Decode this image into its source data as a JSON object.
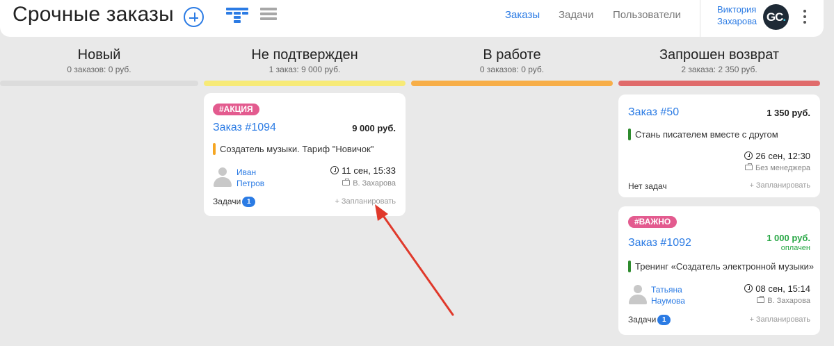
{
  "header": {
    "title": "Срочные заказы",
    "nav": [
      "Заказы",
      "Задачи",
      "Пользователи"
    ],
    "user_first": "Виктория",
    "user_last": "Захарова",
    "avatar_initials": "GC",
    "avatar_dot": "."
  },
  "columns": [
    {
      "title": "Новый",
      "summary": "0 заказов: 0 руб.",
      "color": "#dcdcdc"
    },
    {
      "title": "Не подтвержден",
      "summary": "1 заказ: 9 000 руб.",
      "color": "#f7ea77"
    },
    {
      "title": "В работе",
      "summary": "0 заказов: 0 руб.",
      "color": "#f7ae48"
    },
    {
      "title": "Запрошен возврат",
      "summary": "2 заказа: 2 350 руб.",
      "color": "#e06b6b"
    }
  ],
  "cards": {
    "c1094": {
      "tag": "#АКЦИЯ",
      "order": "Заказ #1094",
      "price": "9 000 руб.",
      "product": "Создатель музыки. Тариф \"Новичок\"",
      "product_color": "#f5a623",
      "client_first": "Иван",
      "client_last": "Петров",
      "deadline": "11 сен, 15:33",
      "manager": "В. Захарова",
      "tasks_label": "Задачи",
      "tasks_count": "1",
      "plan": "+ Запланировать"
    },
    "c50": {
      "order": "Заказ #50",
      "price": "1 350 руб.",
      "product": "Стань писателем вместе с другом",
      "product_color": "#2e8b2e",
      "deadline": "26 сен, 12:30",
      "manager": "Без менеджера",
      "tasks_label": "Нет задач",
      "plan": "+ Запланировать"
    },
    "c1092": {
      "tag": "#ВАЖНО",
      "order": "Заказ #1092",
      "price": "1 000 руб.",
      "paid": "оплачен",
      "product": "Тренинг «Создатель электронной музыки»",
      "product_color": "#2e8b2e",
      "client_first": "Татьяна",
      "client_last": "Наумова",
      "deadline": "08 сен, 15:14",
      "manager": "В. Захарова",
      "tasks_label": "Задачи",
      "tasks_count": "1",
      "plan": "+ Запланировать"
    }
  },
  "icons": {
    "add": "plus-circle-icon",
    "kanban": "kanban-view-icon",
    "list": "list-view-icon",
    "more": "more-vertical-icon",
    "clock": "clock-icon",
    "manager": "briefcase-icon",
    "client": "user-silhouette-icon"
  },
  "annotation": {
    "color": "#e0392b"
  }
}
